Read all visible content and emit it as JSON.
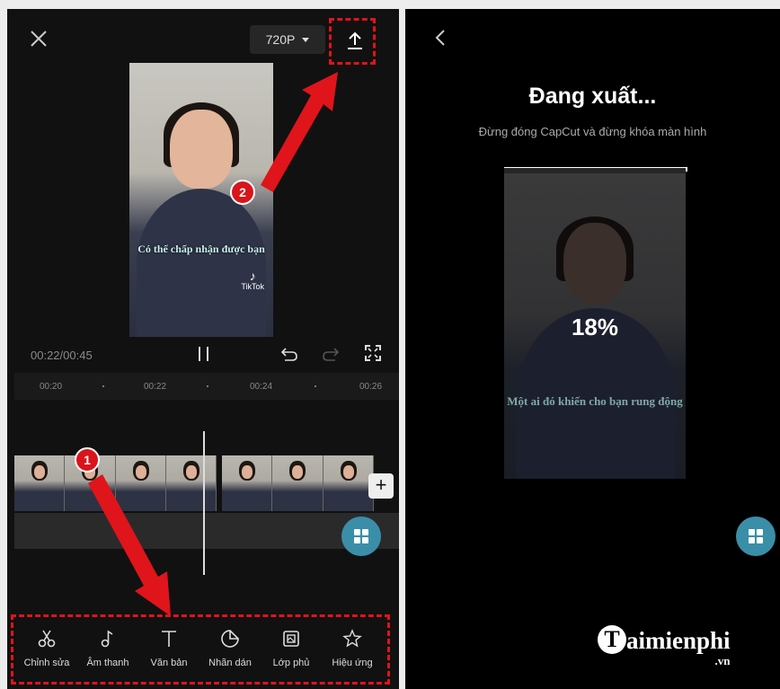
{
  "editor": {
    "resolution": "720P",
    "timecode": "00:22/00:45",
    "ruler_ticks": [
      "00:20",
      "00:22",
      "00:24",
      "00:26"
    ],
    "preview_caption": "Có thể chấp nhận được bạn",
    "watermark": "TikTok",
    "add_label": "+",
    "tools": [
      {
        "label": "Chỉnh sửa",
        "icon": "scissors-icon"
      },
      {
        "label": "Âm thanh",
        "icon": "music-note-icon"
      },
      {
        "label": "Văn bản",
        "icon": "text-icon"
      },
      {
        "label": "Nhãn dán",
        "icon": "sticker-icon"
      },
      {
        "label": "Lớp phủ",
        "icon": "overlay-icon"
      },
      {
        "label": "Hiệu ứng",
        "icon": "effects-icon"
      }
    ],
    "badges": [
      "1",
      "2"
    ],
    "annotation_color": "#e0141b"
  },
  "export": {
    "title": "Đang xuất...",
    "subtitle": "Đừng đóng CapCut và đừng khóa màn hình",
    "progress_label": "18%",
    "progress": 0.18,
    "preview_caption": "Một ai đó khiến cho bạn rung động",
    "accent": "#3b8ea8"
  },
  "branding": {
    "logo_letter": "T",
    "name": "aimienphi",
    "suffix": ".vn"
  }
}
